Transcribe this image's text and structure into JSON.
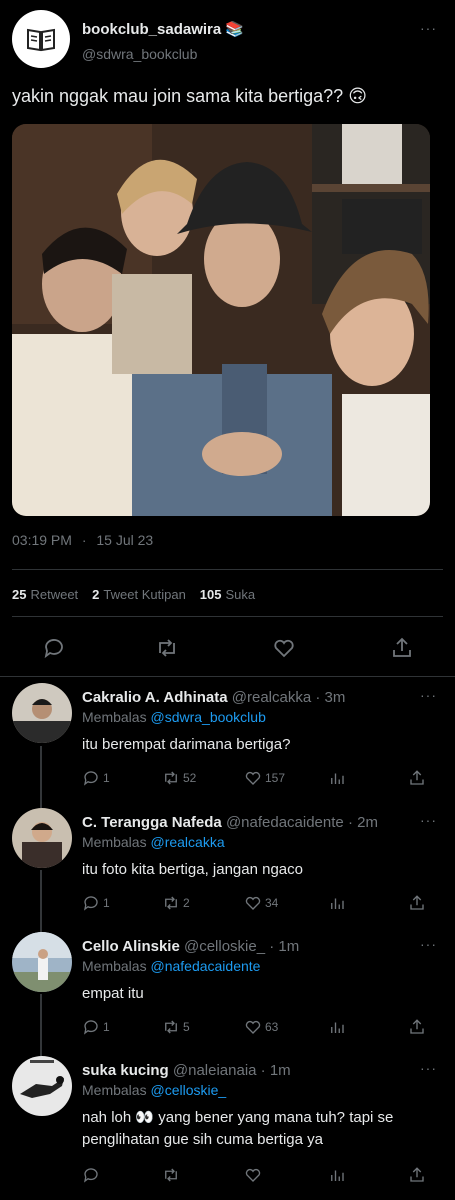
{
  "tweet": {
    "display_name": "bookclub_sadawira 📚",
    "handle": "@sdwra_bookclub",
    "text": "yakin nggak mau join sama kita bertiga?? 🙃",
    "time": "03:19 PM",
    "separator": "·",
    "date": "15 Jul 23",
    "retweets_count": "25",
    "retweets_label": "Retweet",
    "quotes_count": "2",
    "quotes_label": "Tweet Kutipan",
    "likes_count": "105",
    "likes_label": "Suka",
    "more": "···"
  },
  "replies": [
    {
      "name": "Cakralio A. Adhinata",
      "handle": "@realcakka",
      "time": "· 3m",
      "replying_label": "Membalas",
      "replying_to": "@sdwra_bookclub",
      "text": "itu berempat darimana bertiga?",
      "reply_count": "1",
      "retweet_count": "52",
      "like_count": "157",
      "more": "···"
    },
    {
      "name": "C. Terangga Nafeda",
      "handle": "@nafedacaidente",
      "time": "· 2m",
      "replying_label": "Membalas",
      "replying_to": "@realcakka",
      "text": "itu foto kita bertiga, jangan ngaco",
      "reply_count": "1",
      "retweet_count": "2",
      "like_count": "34",
      "more": "···"
    },
    {
      "name": "Cello Alinskie",
      "handle": "@celloskie_",
      "time": "· 1m",
      "replying_label": "Membalas",
      "replying_to": "@nafedacaidente",
      "text": "empat itu",
      "reply_count": "1",
      "retweet_count": "5",
      "like_count": "63",
      "more": "···"
    },
    {
      "name": "suka kucing",
      "handle": "@naleianaia",
      "time": "· 1m",
      "replying_label": "Membalas",
      "replying_to": "@celloskie_",
      "text": "nah loh 👀 yang bener yang mana tuh? tapi se penglihatan gue sih cuma bertiga ya",
      "reply_count": "",
      "retweet_count": "",
      "like_count": "",
      "more": "···"
    }
  ],
  "colors": {
    "background": "#000000",
    "text": "#e7e9ea",
    "muted": "#71767b",
    "link": "#1d9bf0",
    "divider": "#2f3336"
  }
}
